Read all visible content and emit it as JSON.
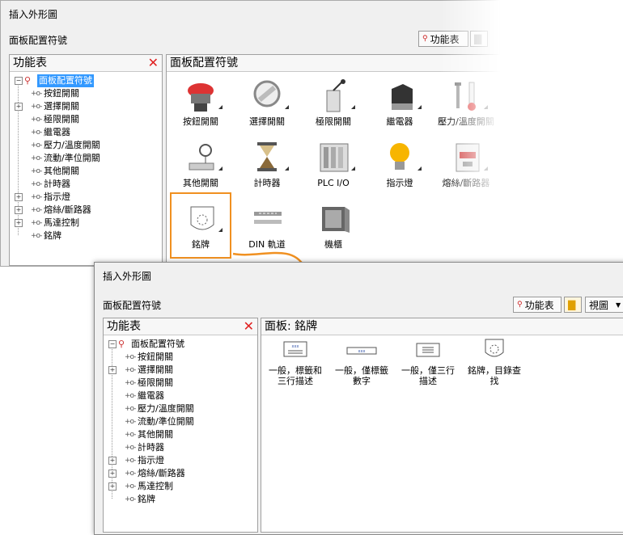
{
  "win1": {
    "title": "插入外形圖",
    "subtitle": "面板配置符號",
    "toolbar_menu": "功能表",
    "menu_panel_title": "功能表",
    "content_title": "面板配置符號",
    "tree": [
      {
        "label": "面板配置符號",
        "exp": "−",
        "root": true
      },
      {
        "label": "按鈕開關",
        "exp": ""
      },
      {
        "label": "選擇開關",
        "exp": "+"
      },
      {
        "label": "極限開關",
        "exp": ""
      },
      {
        "label": "繼電器",
        "exp": ""
      },
      {
        "label": "壓力/溫度開關",
        "exp": ""
      },
      {
        "label": "流動/準位開關",
        "exp": ""
      },
      {
        "label": "其他開關",
        "exp": ""
      },
      {
        "label": "計時器",
        "exp": ""
      },
      {
        "label": "指示燈",
        "exp": "+"
      },
      {
        "label": "熔絲/斷路器",
        "exp": "+"
      },
      {
        "label": "馬達控制",
        "exp": "+"
      },
      {
        "label": "銘牌",
        "exp": ""
      }
    ],
    "icons": [
      {
        "label": "按鈕開關",
        "icon": "push-button-icon"
      },
      {
        "label": "選擇開關",
        "icon": "selector-switch-icon"
      },
      {
        "label": "極限開關",
        "icon": "limit-switch-icon"
      },
      {
        "label": "繼電器",
        "icon": "relay-icon"
      },
      {
        "label": "壓力/溫度開關",
        "icon": "pressure-temp-switch-icon"
      },
      {
        "label": "其他開關",
        "icon": "other-switch-icon"
      },
      {
        "label": "計時器",
        "icon": "timer-icon"
      },
      {
        "label": "PLC I/O",
        "icon": "plc-io-icon"
      },
      {
        "label": "指示燈",
        "icon": "pilot-light-icon"
      },
      {
        "label": "熔絲/斷路器",
        "icon": "fuse-breaker-icon"
      },
      {
        "label": "銘牌",
        "icon": "nameplate-icon"
      },
      {
        "label": "DIN 軌道",
        "icon": "din-rail-icon"
      },
      {
        "label": "機櫃",
        "icon": "enclosure-icon"
      }
    ]
  },
  "win2": {
    "title": "插入外形圖",
    "subtitle": "面板配置符號",
    "toolbar_menu": "功能表",
    "toolbar_view": "視圖",
    "menu_panel_title": "功能表",
    "content_title": "面板: 銘牌",
    "tree": [
      {
        "label": "面板配置符號",
        "exp": "−",
        "root": true
      },
      {
        "label": "按鈕開關",
        "exp": ""
      },
      {
        "label": "選擇開關",
        "exp": "+"
      },
      {
        "label": "極限開關",
        "exp": ""
      },
      {
        "label": "繼電器",
        "exp": ""
      },
      {
        "label": "壓力/溫度開關",
        "exp": ""
      },
      {
        "label": "流動/準位開關",
        "exp": ""
      },
      {
        "label": "其他開關",
        "exp": ""
      },
      {
        "label": "計時器",
        "exp": ""
      },
      {
        "label": "指示燈",
        "exp": "+"
      },
      {
        "label": "熔絲/斷路器",
        "exp": "+"
      },
      {
        "label": "馬達控制",
        "exp": "+"
      },
      {
        "label": "銘牌",
        "exp": ""
      }
    ],
    "components": [
      {
        "line1": "一般，標籤和",
        "line2": "三行描述"
      },
      {
        "line1": "一般，僅標籤",
        "line2": "數字"
      },
      {
        "line1": "一般，僅三行",
        "line2": "描述"
      },
      {
        "line1": "銘牌，目錄查",
        "line2": "找"
      }
    ]
  },
  "colors": {
    "accent_orange": "#f09020",
    "selection": "#3399ff",
    "close_red": "#e02020"
  }
}
